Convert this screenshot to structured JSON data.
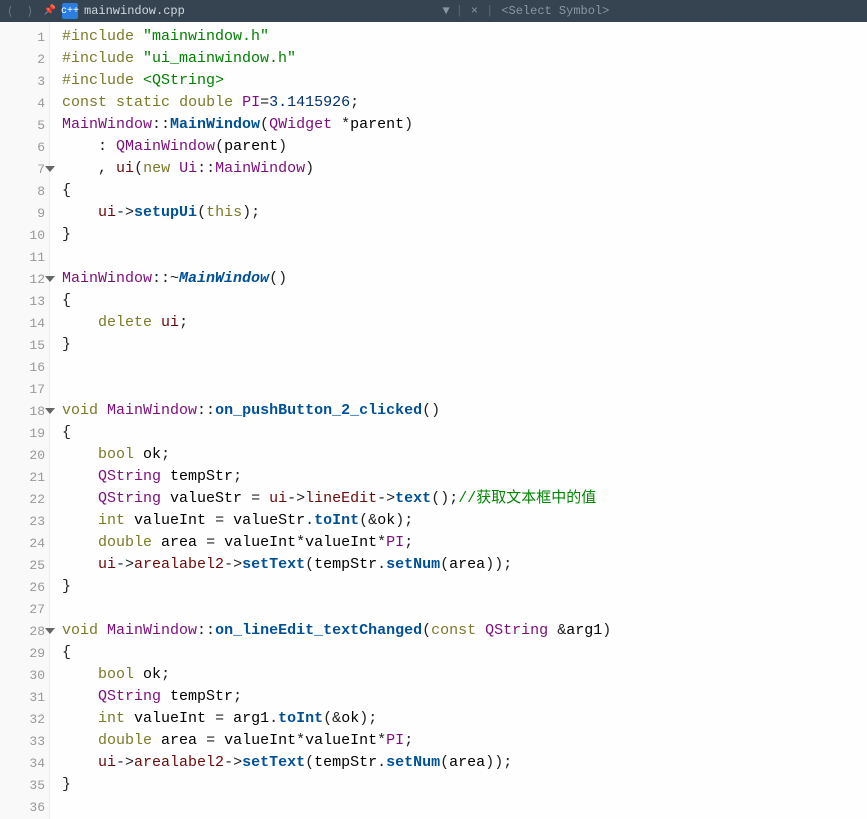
{
  "topbar": {
    "nav_back": "⟨",
    "nav_fwd": "⟩",
    "pin": "📌",
    "file_icon": "c++",
    "filename": "mainwindow.cpp",
    "dropdown": "▼",
    "close": "×",
    "divider": "|",
    "symbol_selector": "<Select Symbol>"
  },
  "gutter": [
    "1",
    "2",
    "3",
    "4",
    "5",
    "6",
    "7",
    "8",
    "9",
    "10",
    "11",
    "12",
    "13",
    "14",
    "15",
    "16",
    "17",
    "18",
    "19",
    "20",
    "21",
    "22",
    "23",
    "24",
    "25",
    "26",
    "27",
    "28",
    "29",
    "30",
    "31",
    "32",
    "33",
    "34",
    "35",
    "36"
  ],
  "folds": {
    "7": true,
    "12": true,
    "18": true,
    "28": true
  },
  "tok": {
    "include": "#include",
    "const": "const",
    "static": "static",
    "double": "double",
    "void": "void",
    "int": "int",
    "bool": "bool",
    "new": "new",
    "delete": "delete",
    "this": "this",
    "mainwindow_h": "\"mainwindow.h\"",
    "ui_mainwindow_h": "\"ui_mainwindow.h\"",
    "qstring_inc": "<QString>",
    "MainWindow": "MainWindow",
    "QWidget": "QWidget",
    "QMainWindow": "QMainWindow",
    "Ui": "Ui",
    "QString": "QString",
    "PI": "PI",
    "pi_val": "3.1415926",
    "ctor": "MainWindow",
    "dtor": "MainWindow",
    "setupUi": "setupUi",
    "on_pb2": "on_pushButton_2_clicked",
    "on_le": "on_lineEdit_textChanged",
    "ok": "ok",
    "tempStr": "tempStr",
    "valueStr": "valueStr",
    "valueInt": "valueInt",
    "area": "area",
    "ui": "ui",
    "parent": "parent",
    "arg1": "arg1",
    "lineEdit": "lineEdit",
    "text": "text",
    "toInt": "toInt",
    "arealabel2": "arealabel2",
    "setText": "setText",
    "setNum": "setNum",
    "cmt1": "//获取文本框中的值",
    "eq": "=",
    "star": "*",
    "amp": "&",
    "ob": "(",
    "cb": ")",
    "oc": "{",
    "cc": "}",
    "sc": ";",
    "col": ":",
    "dcol": "::",
    "arr": "->",
    "lt": "<",
    "gt": ">",
    "comma": ",",
    "tilde": "~",
    "dot": "."
  }
}
